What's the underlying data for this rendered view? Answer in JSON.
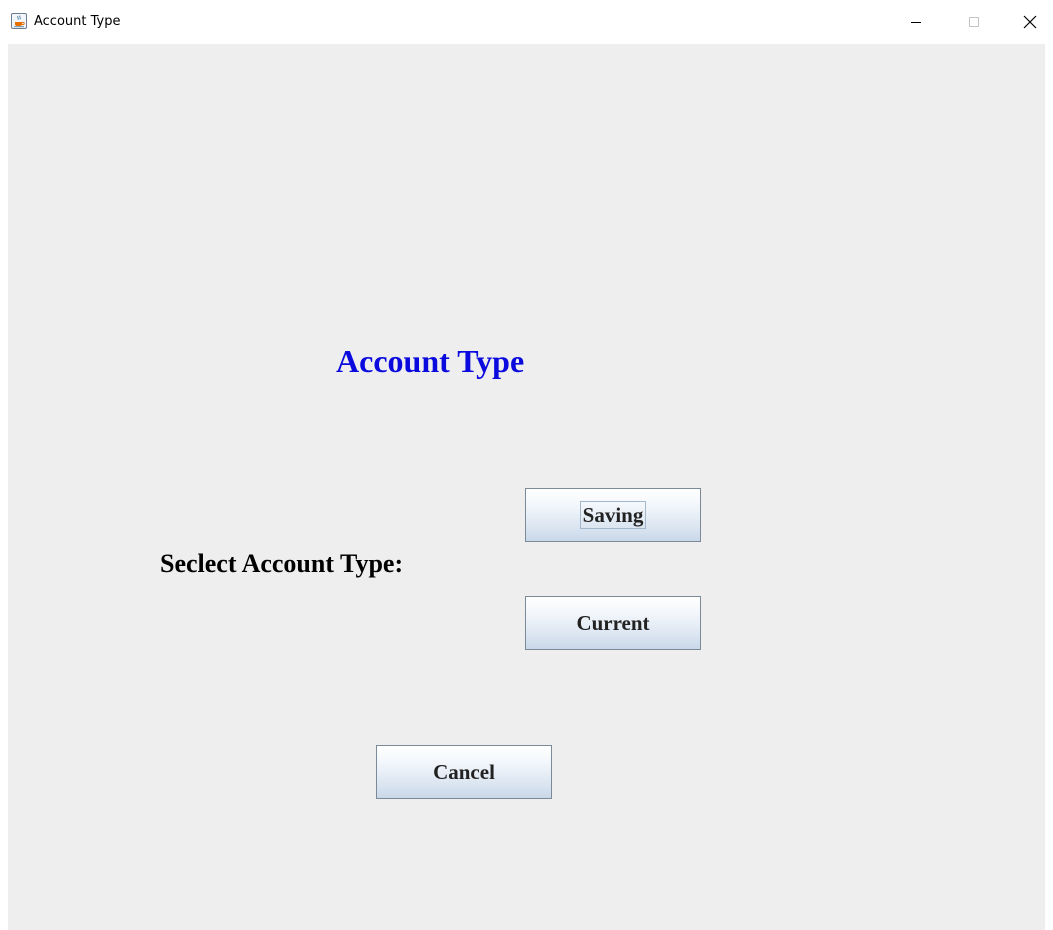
{
  "window": {
    "title": "Account Type",
    "app_icon": "java-cup-icon",
    "controls": {
      "minimize_icon": "minimize-icon",
      "maximize_icon": "maximize-icon",
      "close_icon": "close-icon"
    }
  },
  "content": {
    "heading": "Account Type",
    "select_label": "Seclect Account Type:",
    "buttons": {
      "saving": "Saving",
      "current": "Current",
      "cancel": "Cancel"
    },
    "focused_button": "Saving"
  },
  "colors": {
    "heading": "#0a0adf",
    "background": "#eeeeee",
    "label": "#000000"
  }
}
